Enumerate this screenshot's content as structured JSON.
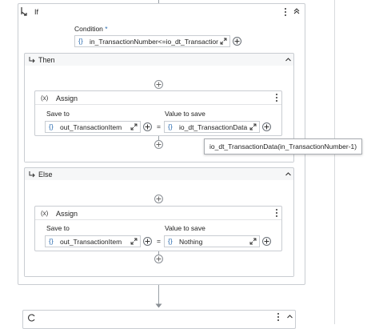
{
  "if_block": {
    "title": "If",
    "condition_label": "Condition",
    "required_mark": "*",
    "condition_value": "in_TransactionNumber<=io_dt_Transactior"
  },
  "then_block": {
    "title": "Then",
    "assign": {
      "title": "Assign",
      "save_to_label": "Save to",
      "value_label": "Value to save",
      "save_to_value": "out_TransactionItem",
      "equals": "=",
      "value_value": "io_dt_TransactionData"
    }
  },
  "tooltip": {
    "text": "io_dt_TransactionData(in_TransactionNumber-1)"
  },
  "else_block": {
    "title": "Else",
    "assign": {
      "title": "Assign",
      "save_to_label": "Save to",
      "value_label": "Value to save",
      "save_to_value": "out_TransactionItem",
      "equals": "=",
      "value_value": "Nothing"
    }
  },
  "icons": {
    "if_icon": "branch-arrow-icon",
    "assign_icon": "x-variable-icon",
    "expression_icon": "curly-braces-icon",
    "expand_icon": "expand-diagonal-icon",
    "add_icon": "plus-circle-icon",
    "collapse_icon": "chevron-up-icon",
    "more_icon": "kebab-menu-icon"
  },
  "colors": {
    "border": "#c9cdd2",
    "connector": "#9aa0a6",
    "accent": "#2b6cb0"
  }
}
